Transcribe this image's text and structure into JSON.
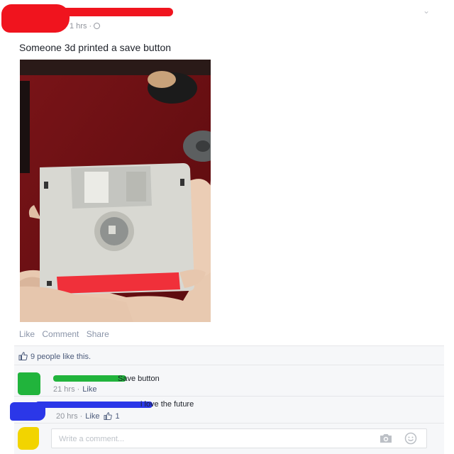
{
  "post": {
    "time": "1 hrs ·",
    "text": "Someone 3d printed a save button"
  },
  "actions": {
    "like": "Like",
    "comment": "Comment",
    "share": "Share"
  },
  "likes": {
    "text": "9 people like this."
  },
  "comments": [
    {
      "text": "Save button",
      "time": "21 hrs ·",
      "like_label": "Like"
    },
    {
      "text": "i love the future",
      "time": "20 hrs ·",
      "like_label": "Like",
      "like_count": "1"
    }
  ],
  "composer": {
    "placeholder": "Write a comment..."
  },
  "colors": {
    "redact_red": "#f0141e",
    "redact_green": "#21b43c",
    "redact_blue": "#2b37e8",
    "redact_yellow": "#f2d400",
    "link": "#4b5a7a",
    "floppy_shutter_red": "#f0303a"
  },
  "icons": {
    "privacy": "globe-icon",
    "menu": "chevron-down-icon",
    "like": "thumbs-up-icon",
    "camera": "camera-icon",
    "sticker": "smiley-icon"
  }
}
